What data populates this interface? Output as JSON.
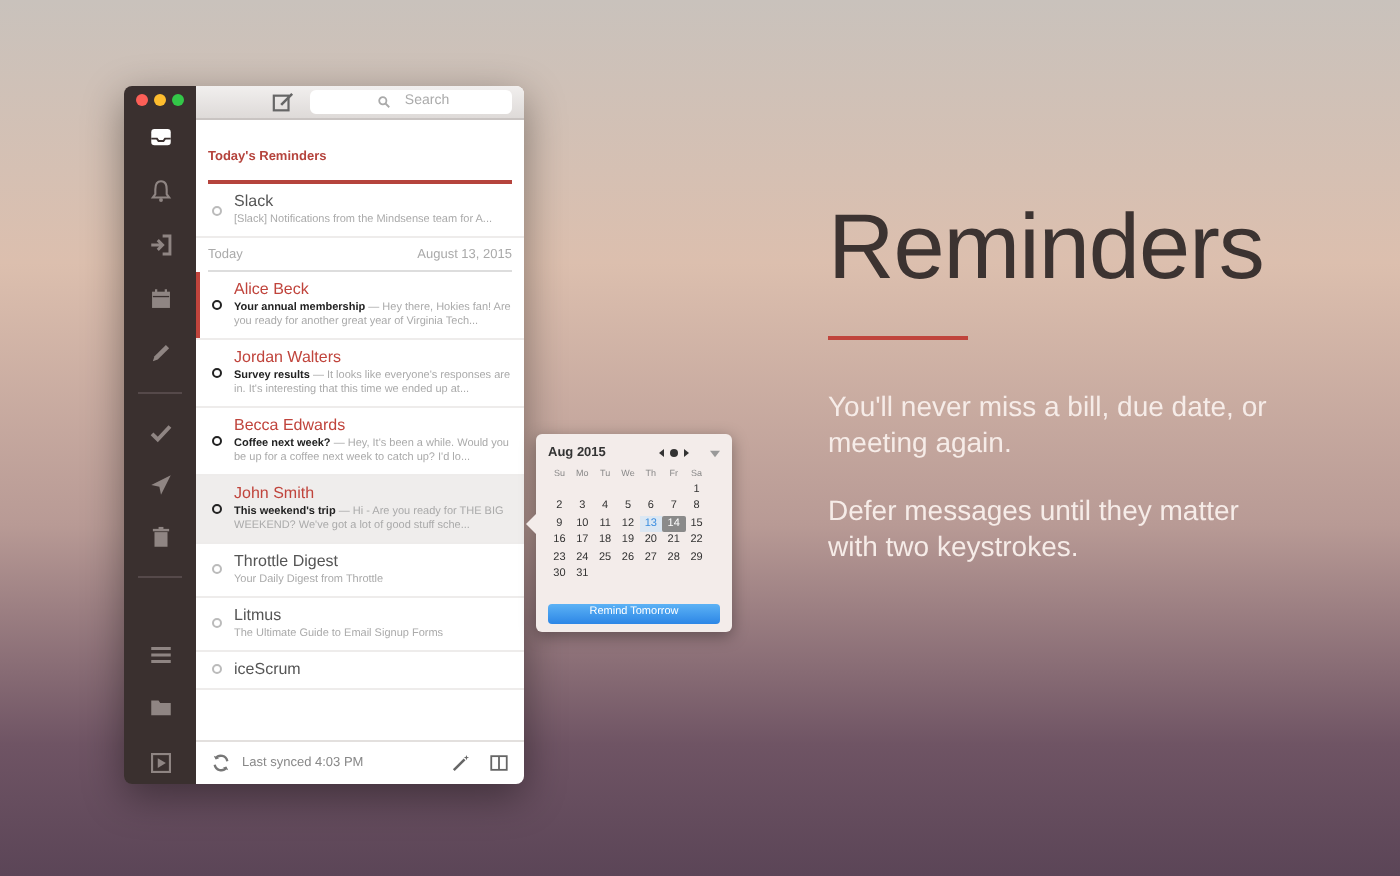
{
  "sidebar": {
    "top_items": [
      {
        "kind": "inbox",
        "selected": true
      },
      {
        "kind": "bell",
        "selected": false
      },
      {
        "kind": "signin",
        "selected": false
      },
      {
        "kind": "calendar",
        "selected": false
      },
      {
        "kind": "pencil",
        "selected": false
      }
    ],
    "middle_items": [
      {
        "kind": "check",
        "selected": false
      },
      {
        "kind": "send",
        "selected": false
      },
      {
        "kind": "trash",
        "selected": false
      }
    ],
    "bottom_items": [
      {
        "kind": "list",
        "selected": false
      },
      {
        "kind": "folder",
        "selected": false
      }
    ]
  },
  "toolbar": {
    "search": {
      "placeholder": "Search"
    }
  },
  "list": {
    "section_title": "Today's Reminders",
    "reminders": [
      {
        "sender": "Slack",
        "preview": "[Slack] Notifications from the Mindsense team for A...",
        "unread": false
      }
    ],
    "date_header": {
      "label": "Today",
      "date": "August 13, 2015"
    },
    "messages": [
      {
        "sender": "Alice Beck",
        "subject": "Your annual membership",
        "preview": "— Hey there, Hokies fan! Are you ready for another great year of Virginia Tech...",
        "unread": true,
        "selected": false,
        "marked": true
      },
      {
        "sender": "Jordan Walters",
        "subject": "Survey results",
        "preview": "— It looks like everyone's responses are in. It's interesting that this time we ended up at...",
        "unread": true,
        "selected": false,
        "marked": false
      },
      {
        "sender": "Becca Edwards",
        "subject": "Coffee next week?",
        "preview": "— Hey, It's been a while. Would you be up for a coffee next week to catch up? I'd lo...",
        "unread": true,
        "selected": false,
        "marked": false
      },
      {
        "sender": "John Smith",
        "subject": "This weekend's trip",
        "preview": "— Hi - Are you ready for THE BIG WEEKEND? We've got a lot of good stuff sche...",
        "unread": true,
        "selected": true,
        "marked": false
      },
      {
        "sender": "Throttle Digest",
        "preview": "Your Daily Digest from Throttle",
        "unread": false,
        "selected": false,
        "marked": false
      },
      {
        "sender": "Litmus",
        "preview": "The Ultimate Guide to Email Signup Forms",
        "unread": false,
        "selected": false,
        "marked": false
      },
      {
        "sender": "iceScrum",
        "unread": false,
        "selected": false,
        "marked": false
      }
    ]
  },
  "footer": {
    "sync_status": "Last synced 4:03 PM"
  },
  "calendar_popover": {
    "month": "Aug 2015",
    "weekdays": [
      "Su",
      "Mo",
      "Tu",
      "We",
      "Th",
      "Fr",
      "Sa"
    ],
    "weeks": [
      [
        {
          "label": "1",
          "today": false,
          "selected": false
        }
      ],
      [
        {
          "label": "2",
          "today": false,
          "selected": false
        },
        {
          "label": "3",
          "today": false,
          "selected": false
        },
        {
          "label": "4",
          "today": false,
          "selected": false
        },
        {
          "label": "5",
          "today": false,
          "selected": false
        },
        {
          "label": "6",
          "today": false,
          "selected": false
        },
        {
          "label": "7",
          "today": false,
          "selected": false
        },
        {
          "label": "8",
          "today": false,
          "selected": false
        }
      ],
      [
        {
          "label": "9",
          "today": false,
          "selected": false
        },
        {
          "label": "10",
          "today": false,
          "selected": false
        },
        {
          "label": "11",
          "today": false,
          "selected": false
        },
        {
          "label": "12",
          "today": false,
          "selected": false
        },
        {
          "label": "13",
          "today": true,
          "selected": false
        },
        {
          "label": "14",
          "today": false,
          "selected": true
        },
        {
          "label": "15",
          "today": false,
          "selected": false
        }
      ],
      [
        {
          "label": "16",
          "today": false,
          "selected": false
        },
        {
          "label": "17",
          "today": false,
          "selected": false
        },
        {
          "label": "18",
          "today": false,
          "selected": false
        },
        {
          "label": "19",
          "today": false,
          "selected": false
        },
        {
          "label": "20",
          "today": false,
          "selected": false
        },
        {
          "label": "21",
          "today": false,
          "selected": false
        },
        {
          "label": "22",
          "today": false,
          "selected": false
        }
      ],
      [
        {
          "label": "23",
          "today": false,
          "selected": false
        },
        {
          "label": "24",
          "today": false,
          "selected": false
        },
        {
          "label": "25",
          "today": false,
          "selected": false
        },
        {
          "label": "26",
          "today": false,
          "selected": false
        },
        {
          "label": "27",
          "today": false,
          "selected": false
        },
        {
          "label": "28",
          "today": false,
          "selected": false
        },
        {
          "label": "29",
          "today": false,
          "selected": false
        }
      ],
      [
        {
          "label": "30",
          "today": false,
          "selected": false
        },
        {
          "label": "31",
          "today": false,
          "selected": false
        }
      ]
    ],
    "button": "Remind Tomorrow"
  },
  "promo": {
    "title": "Reminders",
    "paragraphs": [
      "You'll never miss a bill, due date, or meeting again.",
      "Defer messages until they matter with two keystrokes."
    ]
  }
}
